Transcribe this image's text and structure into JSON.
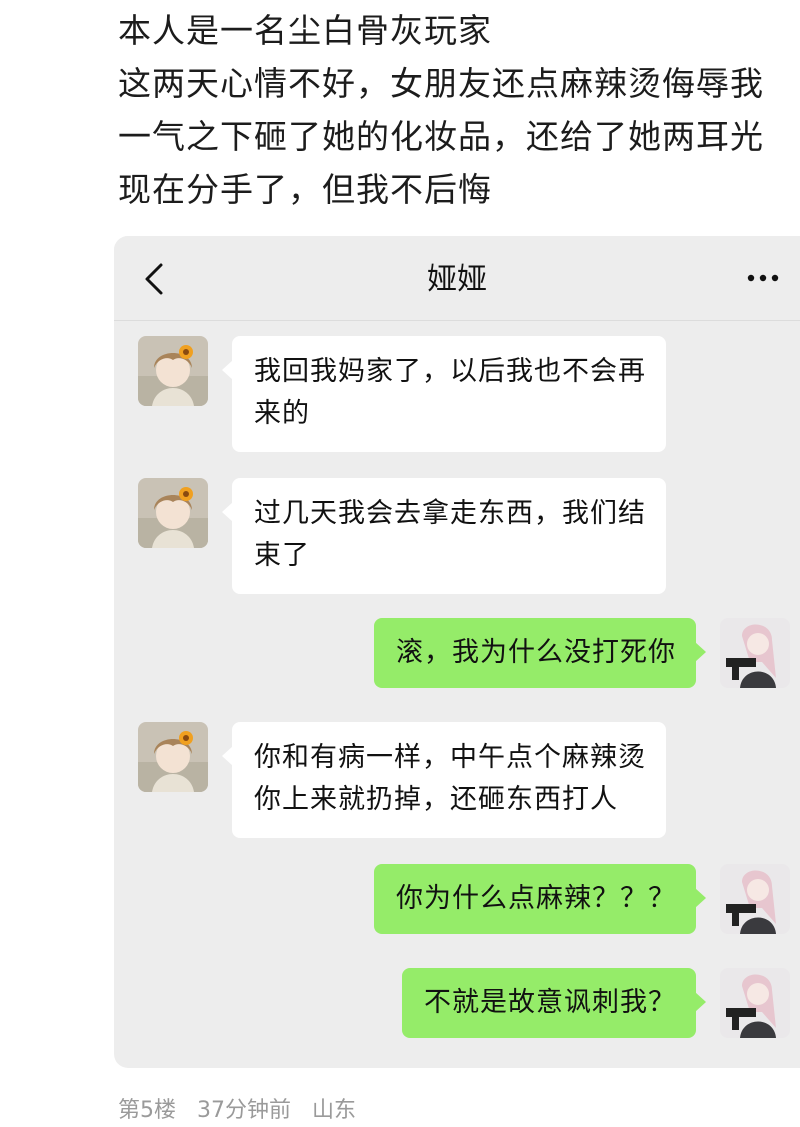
{
  "post": {
    "lines": [
      "本人是一名尘白骨灰玩家",
      "这两天心情不好，女朋友还点麻辣烫侮辱我",
      "一气之下砸了她的化妆品，还给了她两耳光",
      "现在分手了，但我不后悔"
    ]
  },
  "chat": {
    "title": "娅娅",
    "back_icon": "chevron-left-icon",
    "more_icon": "more-dots-icon",
    "messages": [
      {
        "side": "in",
        "lines": [
          "我回我妈家了，以后我也不会再",
          "来的"
        ]
      },
      {
        "side": "in",
        "lines": [
          "过几天我会去拿走东西，我们结",
          "束了"
        ]
      },
      {
        "side": "out",
        "lines": [
          "滚，我为什么没打死你"
        ]
      },
      {
        "side": "in",
        "lines": [
          "你和有病一样，中午点个麻辣烫",
          "你上来就扔掉，还砸东西打人"
        ]
      },
      {
        "side": "out",
        "lines": [
          "你为什么点麻辣？？？"
        ]
      },
      {
        "side": "out",
        "lines": [
          "不就是故意讽刺我？"
        ]
      }
    ]
  },
  "meta": {
    "floor": "第5楼",
    "time": "37分钟前",
    "location": "山东"
  },
  "colors": {
    "chat_background": "#ededed",
    "incoming_bubble": "#ffffff",
    "outgoing_bubble": "#95ec69"
  }
}
